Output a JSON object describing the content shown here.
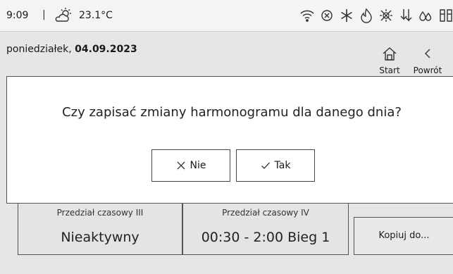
{
  "status_bar": {
    "time": "9:09",
    "separator": "|",
    "temperature": "23.1°C",
    "icons": [
      "wifi-icon",
      "circle-x-icon",
      "snowflake-icon",
      "flame-icon",
      "sun-cross-icon",
      "arrows-down-icon",
      "water-drops-icon",
      "filter-icon"
    ]
  },
  "header": {
    "date_prefix": "poniedziałek,",
    "date_value": "04.09.2023"
  },
  "nav": {
    "start_label": "Start",
    "back_label": "Powrót"
  },
  "panels": [
    {
      "title": "Przedział czasowy III",
      "value": "Nieaktywny"
    },
    {
      "title": "Przedział czasowy IV",
      "value": "00:30 - 2:00 Bieg 1"
    }
  ],
  "copy_button": "Kopiuj do...",
  "dialog": {
    "question": "Czy zapisać zmiany harmonogramu dla danego dnia?",
    "no_label": "Nie",
    "yes_label": "Tak"
  }
}
